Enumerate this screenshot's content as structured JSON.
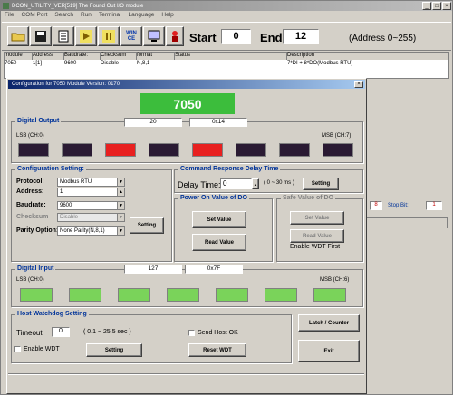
{
  "main_window": {
    "title": "DCON_UTILITY_VER[519] The Found Out I/O module"
  },
  "menu": [
    "File",
    "COM Port",
    "Search",
    "Run",
    "Terminal",
    "Language",
    "Help"
  ],
  "toolbar": {
    "start_label": "Start",
    "start_value": "0",
    "end_label": "End",
    "end_value": "12",
    "address_range": "(Address 0~255)",
    "win_ce": "WIN\nCE"
  },
  "table": {
    "headers": [
      "module",
      "Address",
      "Baudrate:",
      "Checksum",
      "format",
      "Status",
      "Description"
    ],
    "row": [
      "7050",
      "1[1]",
      "9600",
      "Disable",
      "N,8,1",
      "",
      "7*DI + 8*DO(Modbus RTU)"
    ]
  },
  "bg_right": {
    "field1": "8",
    "stop_bit_label": "Stop Bit:",
    "field2": "1"
  },
  "dialog": {
    "title": "Configuration for 7050 Module Version: 0170",
    "module_name": "7050"
  },
  "digital_output": {
    "title": "Digital Output",
    "dec": "20",
    "hex": "0x14",
    "lsb": "LSB (CH:0)",
    "msb": "MSB (CH:7)",
    "states": [
      0,
      0,
      1,
      0,
      1,
      0,
      0,
      0
    ],
    "on_color": "#e82020",
    "off_color": "#2a1a33"
  },
  "config": {
    "title": "Configuration Setting:",
    "protocol_label": "Protocol:",
    "protocol_value": "Modbus RTU",
    "address_label": "Address:",
    "address_value": "1",
    "baudrate_label": "Baudrate:",
    "baudrate_value": "9600",
    "checksum_label": "Checksum",
    "checksum_value": "Disable",
    "parity_label": "Parity Option:",
    "parity_value": "None Parity(N,8,1)",
    "setting_button": "Setting"
  },
  "delay": {
    "title": "Command Response Delay Time",
    "label": "Delay Time:",
    "value": "0",
    "range": "( 0 ~ 30 ms )",
    "setting_button": "Setting"
  },
  "power_on": {
    "title": "Power On Value of DO",
    "set_button": "Set Value",
    "read_button": "Read Value"
  },
  "safe": {
    "title": "Safe Value of DO",
    "set_button": "Set Value",
    "read_button": "Read Value",
    "note": "Enable WDT First"
  },
  "digital_input": {
    "title": "Digital Input",
    "dec": "127",
    "hex": "0x7F",
    "lsb": "LSB (CH:0)",
    "msb": "MSB (CH:6)",
    "states": [
      1,
      1,
      1,
      1,
      1,
      1,
      1
    ],
    "on_color": "#7ad35a"
  },
  "watchdog": {
    "title": "Host Watchdog Setting",
    "timeout_label": "Timeout",
    "timeout_value": "0",
    "range": "( 0.1 ~ 25.5 sec )",
    "enable_wdt": "Enable WDT",
    "setting_button": "Setting",
    "send_host_ok": "Send Host OK",
    "reset_button": "Reset WDT"
  },
  "latch_button": "Latch / Counter",
  "exit_button": "Exit"
}
